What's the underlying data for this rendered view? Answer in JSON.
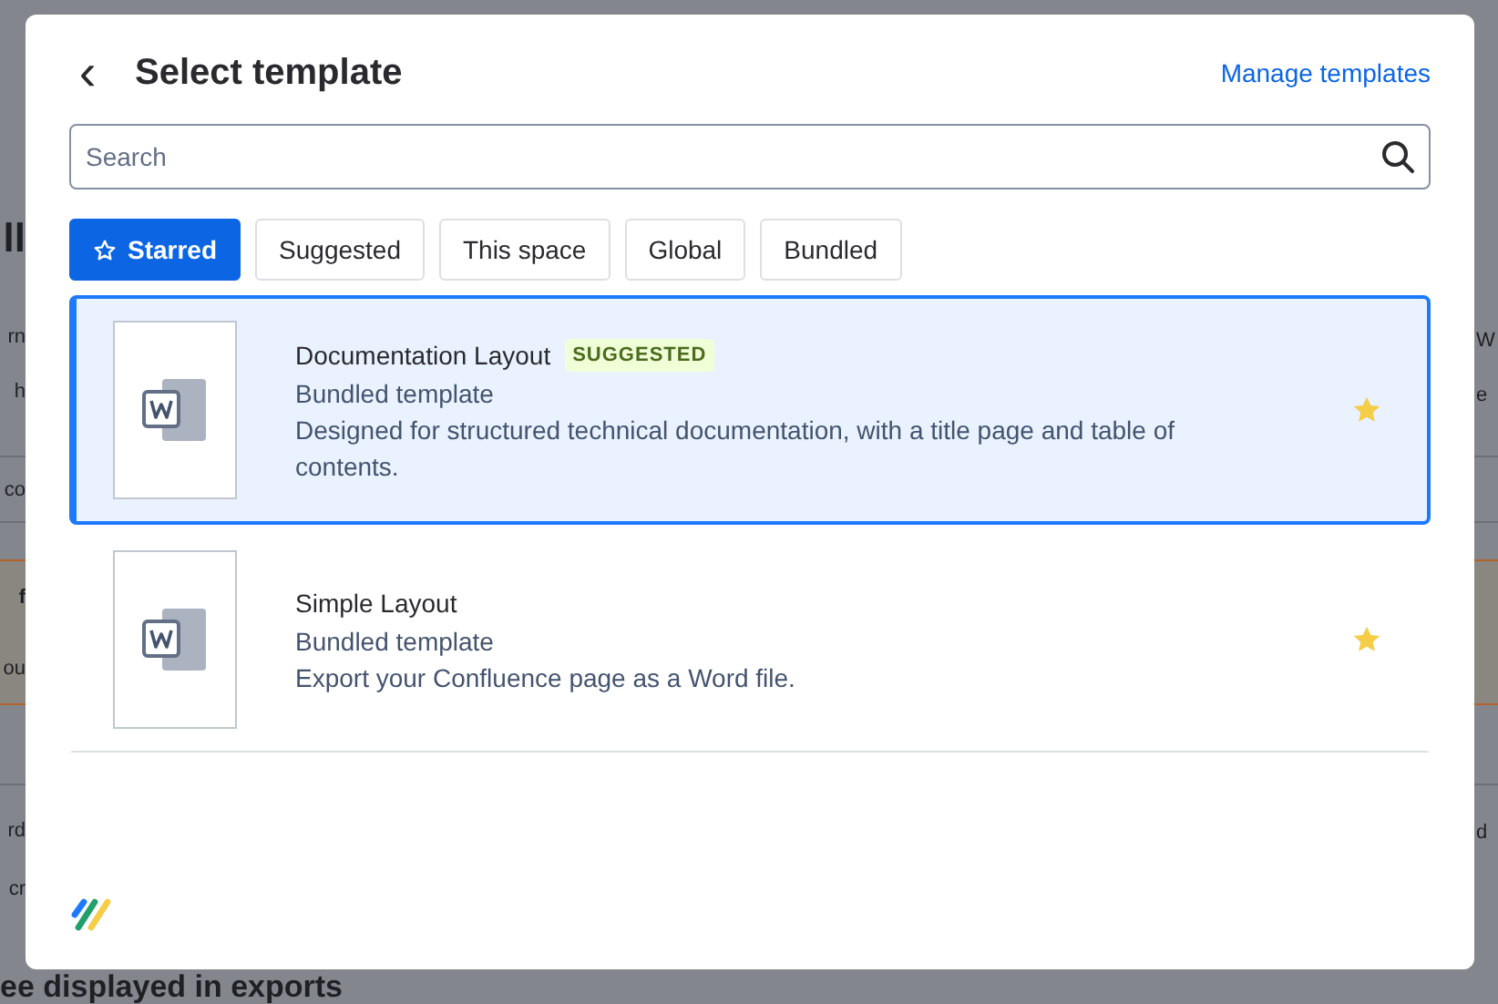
{
  "background": {
    "rows": [
      {
        "kind": "heading",
        "left": "ll"
      },
      {
        "kind": "text",
        "left": "rn",
        "right": "W"
      },
      {
        "kind": "text",
        "left": "h",
        "right": "e"
      },
      {
        "kind": "text",
        "left": "co"
      },
      {
        "kind": "callout",
        "left": "f",
        "left_2": "ou"
      },
      {
        "kind": "text",
        "left": "rd",
        "right": "d"
      },
      {
        "kind": "text",
        "left": "cr"
      },
      {
        "kind": "heading",
        "left": "ee displayed in exports"
      }
    ]
  },
  "dialog": {
    "back": "‹",
    "title": "Select template",
    "manage_link": "Manage templates",
    "search": {
      "placeholder": "Search"
    },
    "tabs": [
      {
        "label": "Starred",
        "selected": true,
        "starred": true
      },
      {
        "label": "Suggested",
        "selected": false,
        "starred": false
      },
      {
        "label": "This space",
        "selected": false,
        "starred": false
      },
      {
        "label": "Global",
        "selected": false,
        "starred": false
      },
      {
        "label": "Bundled",
        "selected": false,
        "starred": false
      }
    ],
    "templates": [
      {
        "name": "Documentation Layout",
        "badge": "SUGGESTED",
        "type": "Bundled template",
        "description": "Designed for structured technical documentation, with a title page and table of contents.",
        "selected": true,
        "starred": true
      },
      {
        "name": "Simple Layout",
        "type": "Bundled template",
        "description": "Export your Confluence page as a Word file.",
        "selected": false,
        "starred": true
      }
    ]
  }
}
